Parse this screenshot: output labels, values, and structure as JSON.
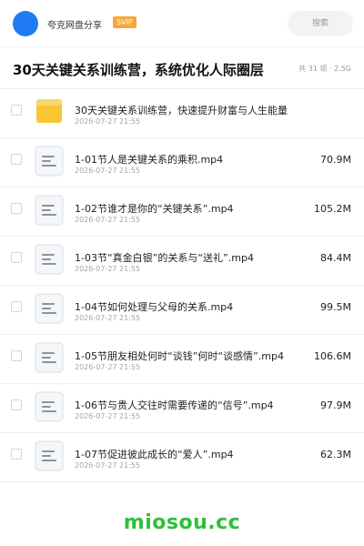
{
  "header": {
    "app_name": "夸克网盘分享",
    "badge": "SVIP",
    "search_placeholder": "搜索"
  },
  "folder": {
    "title": "30天关键关系训练营，系统优化人际圈层",
    "meta": "共 31 项 · 2.5G"
  },
  "files": [
    {
      "type": "folder",
      "name": "30天关键关系训练营，快速提升财富与人生能量",
      "date": "2026-07-27 21:55",
      "size": ""
    },
    {
      "type": "video",
      "name": "1-01节人是关键关系的乘积.mp4",
      "date": "2026-07-27 21:55",
      "size": "70.9M"
    },
    {
      "type": "video",
      "name": "1-02节谁才是你的“关键关系”.mp4",
      "date": "2026-07-27 21:55",
      "size": "105.2M"
    },
    {
      "type": "video",
      "name": "1-03节“真金白银”的关系与“送礼”.mp4",
      "date": "2026-07-27 21:55",
      "size": "84.4M"
    },
    {
      "type": "video",
      "name": "1-04节如何处理与父母的关系.mp4",
      "date": "2026-07-27 21:55",
      "size": "99.5M"
    },
    {
      "type": "video",
      "name": "1-05节朋友相处何时“谈钱”何时“谈感情”.mp4",
      "date": "2026-07-27 21:55",
      "size": "106.6M"
    },
    {
      "type": "video",
      "name": "1-06节与贵人交往时需要传递的“信号”.mp4",
      "date": "2026-07-27 21:55",
      "size": "97.9M"
    },
    {
      "type": "video",
      "name": "1-07节促进彼此成长的“爱人”.mp4",
      "date": "2026-07-27 21:55",
      "size": "62.3M"
    }
  ],
  "watermark": "miosou.cc",
  "colors": {
    "accent": "#1e7bf2",
    "svip": "#f7a637",
    "folder": "#fbc531",
    "watermark": "#2fbf3a"
  }
}
